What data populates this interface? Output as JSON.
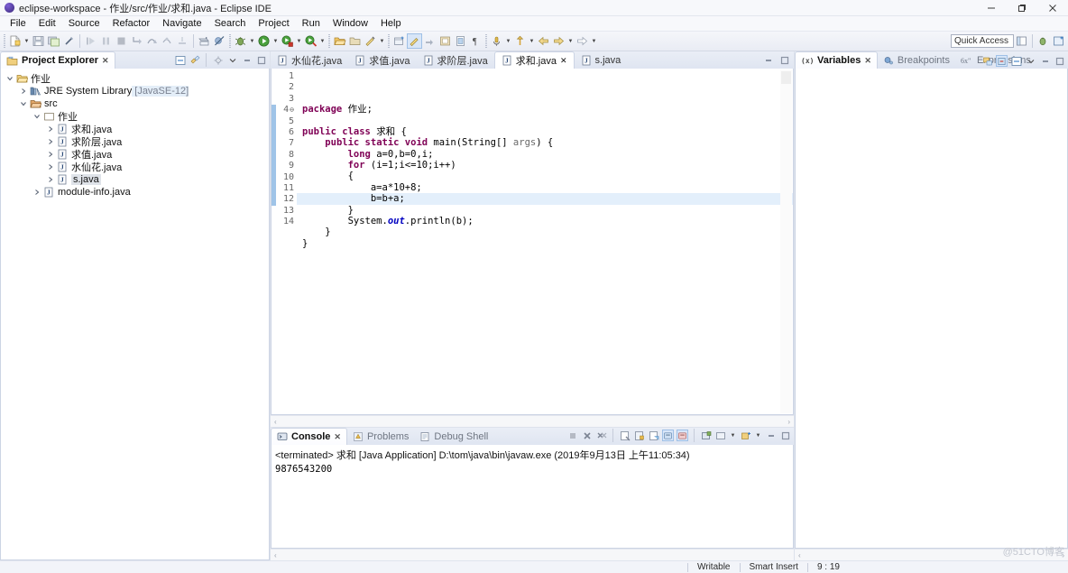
{
  "window": {
    "title": "eclipse-workspace - 作业/src/作业/求和.java - Eclipse IDE",
    "minimize": "—",
    "maximize": "❐",
    "close": "✕"
  },
  "menubar": [
    "File",
    "Edit",
    "Source",
    "Refactor",
    "Navigate",
    "Search",
    "Project",
    "Run",
    "Window",
    "Help"
  ],
  "toolbar": {
    "quick_access": "Quick Access"
  },
  "explorer": {
    "tab_label": "Project Explorer",
    "close_glyph": "✕",
    "tree": [
      {
        "indent": 0,
        "twisty": "v",
        "icon": "project-icon",
        "label": "作业",
        "extra": "",
        "selected": false
      },
      {
        "indent": 1,
        "twisty": ">",
        "icon": "library-icon",
        "label": "JRE System Library",
        "extra": " [JavaSE-12]",
        "selected": false
      },
      {
        "indent": 1,
        "twisty": "v",
        "icon": "source-folder-icon",
        "label": "src",
        "extra": "",
        "selected": false
      },
      {
        "indent": 2,
        "twisty": "v",
        "icon": "package-icon",
        "label": "作业",
        "extra": "",
        "selected": false
      },
      {
        "indent": 3,
        "twisty": ">",
        "icon": "java-file-icon",
        "label": "求和.java",
        "extra": "",
        "selected": false
      },
      {
        "indent": 3,
        "twisty": ">",
        "icon": "java-file-icon",
        "label": "求阶层.java",
        "extra": "",
        "selected": false
      },
      {
        "indent": 3,
        "twisty": ">",
        "icon": "java-file-icon",
        "label": "求值.java",
        "extra": "",
        "selected": false
      },
      {
        "indent": 3,
        "twisty": ">",
        "icon": "java-file-icon",
        "label": "水仙花.java",
        "extra": "",
        "selected": false
      },
      {
        "indent": 3,
        "twisty": ">",
        "icon": "java-file-icon",
        "label": "s.java",
        "extra": "",
        "selected": true
      },
      {
        "indent": 2,
        "twisty": ">",
        "icon": "java-file-icon",
        "label": "module-info.java",
        "extra": "",
        "selected": false
      }
    ]
  },
  "editor": {
    "tabs": [
      {
        "label": "水仙花.java",
        "active": false,
        "closable": false
      },
      {
        "label": "求值.java",
        "active": false,
        "closable": false
      },
      {
        "label": "求阶层.java",
        "active": false,
        "closable": false
      },
      {
        "label": "求和.java",
        "active": true,
        "closable": true
      },
      {
        "label": "s.java",
        "active": false,
        "closable": false
      }
    ],
    "close_glyph": "✕",
    "lines": [
      {
        "n": 1,
        "fold": "",
        "highlight": false,
        "tokens": [
          {
            "t": "package ",
            "c": "kw"
          },
          {
            "t": "作业;",
            "c": ""
          }
        ]
      },
      {
        "n": 2,
        "fold": "",
        "highlight": false,
        "tokens": []
      },
      {
        "n": 3,
        "fold": "",
        "highlight": false,
        "tokens": [
          {
            "t": "public class ",
            "c": "kw"
          },
          {
            "t": "求和 {",
            "c": ""
          }
        ]
      },
      {
        "n": 4,
        "fold": "⊖",
        "highlight": false,
        "tokens": [
          {
            "t": "    ",
            "c": ""
          },
          {
            "t": "public static void ",
            "c": "kw"
          },
          {
            "t": "main(String[] ",
            "c": ""
          },
          {
            "t": "args",
            "c": "par"
          },
          {
            "t": ") {",
            "c": ""
          }
        ]
      },
      {
        "n": 5,
        "fold": "",
        "highlight": false,
        "tokens": [
          {
            "t": "        ",
            "c": ""
          },
          {
            "t": "long ",
            "c": "kw"
          },
          {
            "t": "a=0,b=0,i;",
            "c": ""
          }
        ]
      },
      {
        "n": 6,
        "fold": "",
        "highlight": false,
        "tokens": [
          {
            "t": "        ",
            "c": ""
          },
          {
            "t": "for ",
            "c": "kw"
          },
          {
            "t": "(i=1;i<=10;i++)",
            "c": ""
          }
        ]
      },
      {
        "n": 7,
        "fold": "",
        "highlight": false,
        "tokens": [
          {
            "t": "        {",
            "c": ""
          }
        ]
      },
      {
        "n": 8,
        "fold": "",
        "highlight": false,
        "tokens": [
          {
            "t": "            a=a*10+8;",
            "c": ""
          }
        ]
      },
      {
        "n": 9,
        "fold": "",
        "highlight": true,
        "tokens": [
          {
            "t": "            b=b+a;",
            "c": ""
          }
        ]
      },
      {
        "n": 10,
        "fold": "",
        "highlight": false,
        "tokens": [
          {
            "t": "        }",
            "c": ""
          }
        ]
      },
      {
        "n": 11,
        "fold": "",
        "highlight": false,
        "tokens": [
          {
            "t": "        System.",
            "c": ""
          },
          {
            "t": "out",
            "c": "fld"
          },
          {
            "t": ".println(b);",
            "c": ""
          }
        ]
      },
      {
        "n": 12,
        "fold": "",
        "highlight": false,
        "tokens": [
          {
            "t": "    }",
            "c": ""
          }
        ]
      },
      {
        "n": 13,
        "fold": "",
        "highlight": false,
        "tokens": [
          {
            "t": "}",
            "c": ""
          }
        ]
      },
      {
        "n": 14,
        "fold": "",
        "highlight": false,
        "tokens": []
      }
    ],
    "scroll_left_glyph": "‹",
    "scroll_right_glyph": "›"
  },
  "debug_views": {
    "tabs": [
      {
        "label": "Variables",
        "active": true,
        "icon": "variables-icon",
        "closable": true
      },
      {
        "label": "Breakpoints",
        "active": false,
        "icon": "breakpoints-icon",
        "closable": false
      },
      {
        "label": "Expressions",
        "active": false,
        "icon": "expressions-icon",
        "closable": false
      }
    ],
    "close_glyph": "✕",
    "scroll_left_glyph": "‹",
    "scroll_right_glyph": "›"
  },
  "console": {
    "tabs": [
      {
        "label": "Console",
        "active": true,
        "icon": "console-icon",
        "closable": true
      },
      {
        "label": "Problems",
        "active": false,
        "icon": "problems-icon",
        "closable": false
      },
      {
        "label": "Debug Shell",
        "active": false,
        "icon": "debug-shell-icon",
        "closable": false
      }
    ],
    "close_glyph": "✕",
    "terminated_line": "<terminated> 求和 [Java Application] D:\\tom\\java\\bin\\javaw.exe (2019年9月13日 上午11:05:34)",
    "output": "9876543200",
    "scroll_left_glyph": "‹"
  },
  "statusbar": {
    "writable": "Writable",
    "insert_mode": "Smart Insert",
    "position": "9 : 19"
  },
  "watermark": "@51CTO博客",
  "colors": {
    "keyword": "#7f0055",
    "field": "#0000c0",
    "param": "#6a6a6a",
    "selection": "#e3effb",
    "changebar": "#9fc4e8",
    "tab_active": "#ffffff"
  }
}
